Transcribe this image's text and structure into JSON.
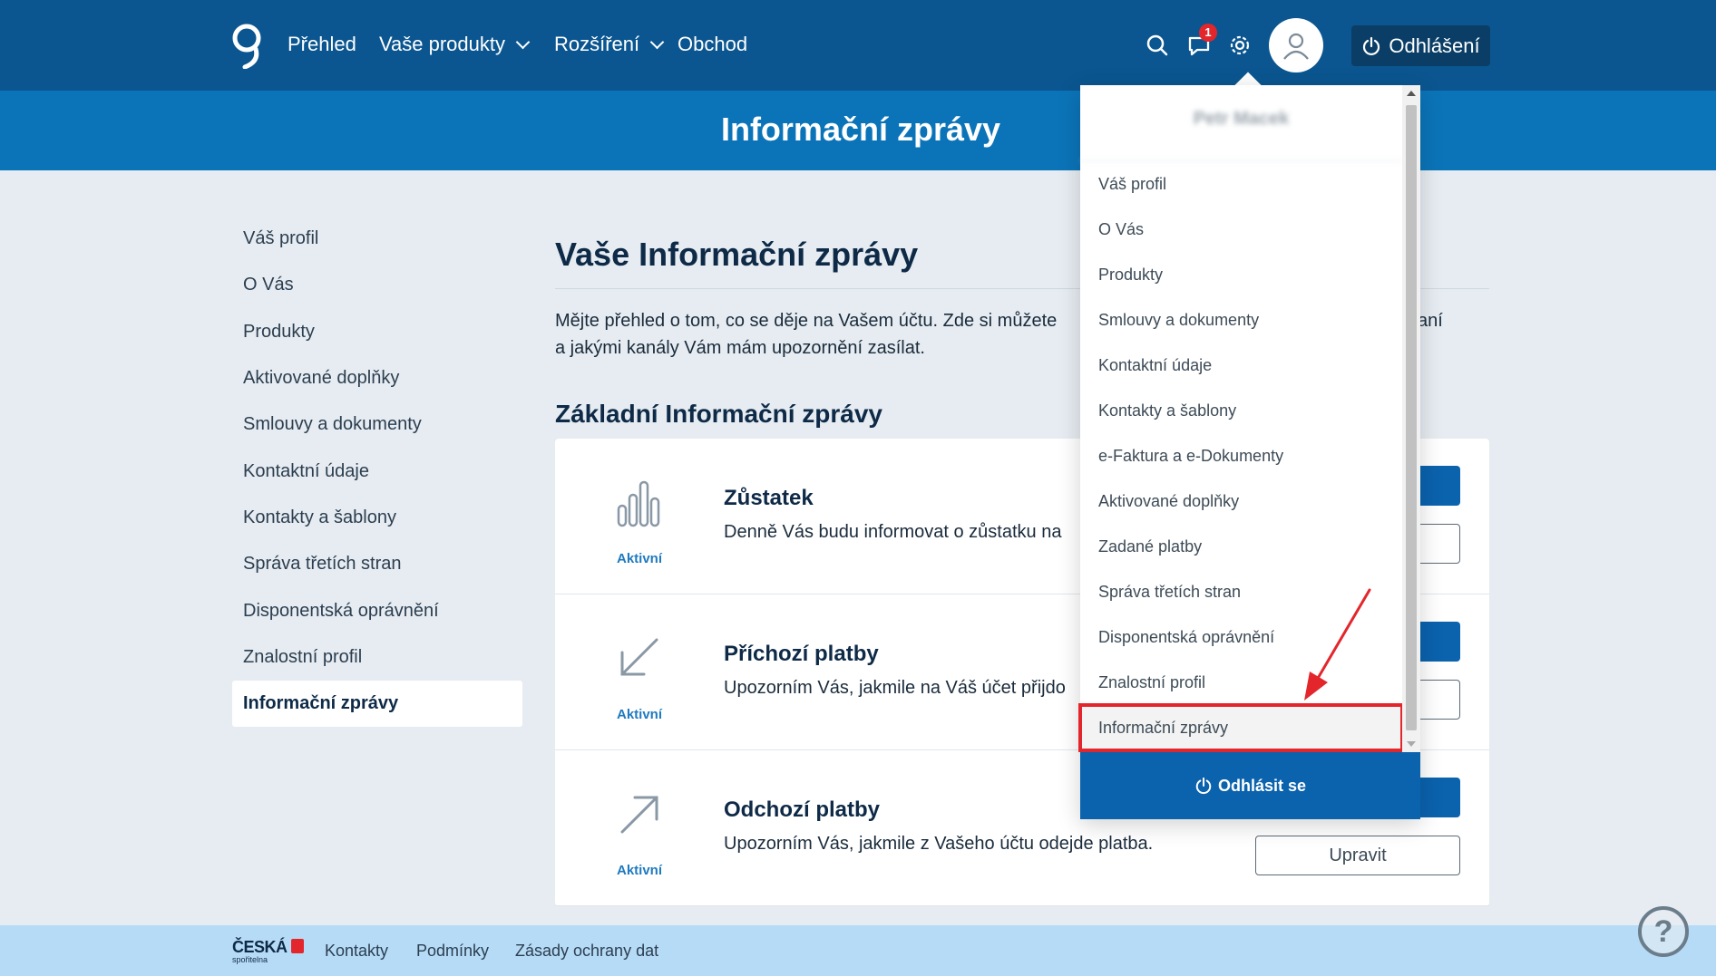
{
  "nav": {
    "items": [
      "Přehled",
      "Vaše produkty",
      "Rozšíření",
      "Obchod"
    ],
    "notification_count": "1",
    "logout_label": "Odhlášení"
  },
  "page_title": "Informační zprávy",
  "sidebar": {
    "items": [
      "Váš profil",
      "O Vás",
      "Produkty",
      "Aktivované doplňky",
      "Smlouvy a dokumenty",
      "Kontaktní údaje",
      "Kontakty a šablony",
      "Správa třetích stran",
      "Disponentská oprávnění",
      "Znalostní profil",
      "Informační zprávy"
    ],
    "active": "Informační zprávy"
  },
  "main": {
    "heading": "Vaše Informační zprávy",
    "intro_line1": "Mějte přehled o tom, co se děje na Vašem účtu. Zde si můžete",
    "intro_line1_end": "movaní",
    "intro_line2": "a jakými kanály Vám mám upozornění zasílat.",
    "subheading": "Základní Informační zprávy",
    "cards": [
      {
        "title": "Zůstatek",
        "desc": "Denně Vás budu informovat o zůstatku na",
        "status": "Aktivní",
        "icon": "bar-chart-icon"
      },
      {
        "title": "Příchozí platby",
        "desc": "Upozorním Vás, jakmile na Váš účet přijdo",
        "status": "Aktivní",
        "icon": "arrow-down-left-icon"
      },
      {
        "title": "Odchozí platby",
        "desc": "Upozorním Vás, jakmile z Vašeho účtu odejde platba.",
        "status": "Aktivní",
        "icon": "arrow-up-right-icon",
        "edit_label": "Upravit"
      }
    ]
  },
  "dropdown": {
    "user_name": "Petr Macek",
    "items": [
      "Váš profil",
      "O Vás",
      "Produkty",
      "Smlouvy a dokumenty",
      "Kontaktní údaje",
      "Kontakty a šablony",
      "e-Faktura a e-Dokumenty",
      "Aktivované doplňky",
      "Zadané platby",
      "Správa třetích stran",
      "Disponentská oprávnění",
      "Znalostní profil",
      "Informační zprávy"
    ],
    "highlighted": "Informační zprávy",
    "logout_label": "Odhlásit se"
  },
  "footer": {
    "brand_line1": "ČESKÁ",
    "brand_line2": "spořitelna",
    "links": [
      "Kontakty",
      "Podmínky",
      "Zásady ochrany dat"
    ]
  },
  "colors": {
    "nav_bg": "#0b5690",
    "title_band": "#0b74b8",
    "primary_button": "#0b62ad",
    "highlight_red": "#e3262c",
    "footer_bg": "#b6dbf6"
  }
}
